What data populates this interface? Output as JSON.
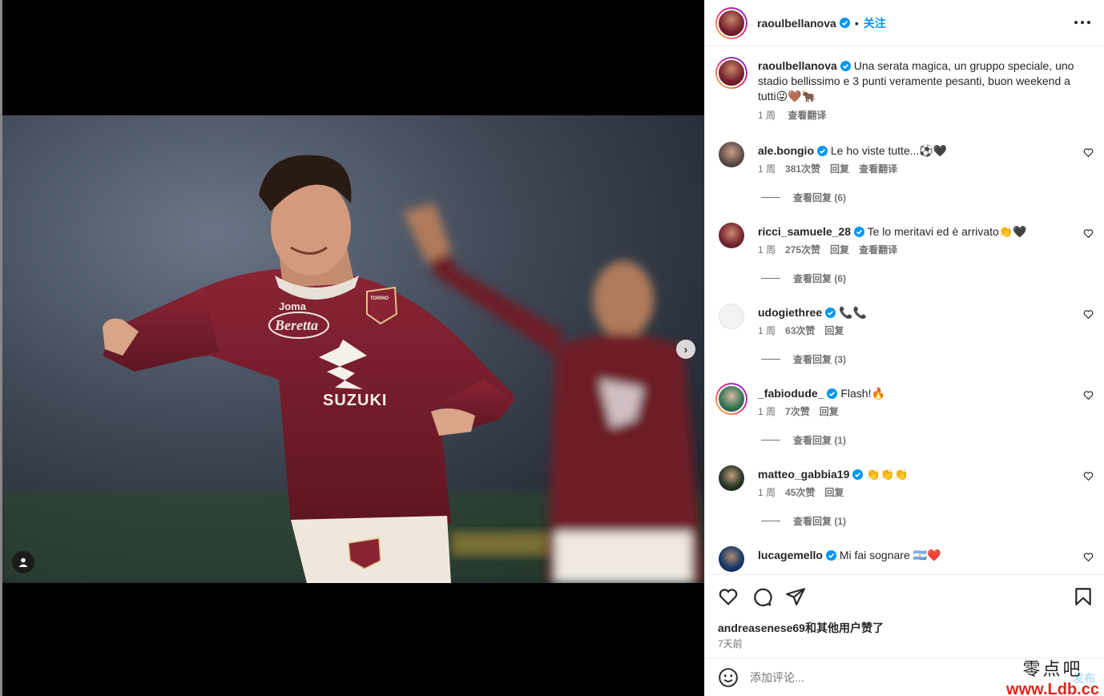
{
  "post": {
    "author": "raoulbellanova",
    "follow_label": "关注",
    "caption_text": "Una serata magica, un gruppo speciale, uno stadio bellissimo e 3 punti veramente pesanti, buon weekend a tutti😜🤎🐂",
    "caption_time": "1 周",
    "caption_translate": "查看翻译",
    "likes_text": "andreasenese69和其他用户赞了",
    "date_text": "7天前"
  },
  "photo": {
    "jersey_brand": "Joma",
    "jersey_sponsor": "Beretta",
    "jersey_main_sponsor": "SUZUKI",
    "jersey_badge": "TORINO"
  },
  "comments": [
    {
      "user": "ale.bongio",
      "text": "Le ho viste tutte...⚽🖤",
      "time": "1 周",
      "likes": "381次赞",
      "reply": "回复",
      "translate": "查看翻译",
      "view_replies": "查看回复 (6)"
    },
    {
      "user": "ricci_samuele_28",
      "text": "Te lo meritavi ed è arrivato👏🖤",
      "time": "1 周",
      "likes": "275次赞",
      "reply": "回复",
      "translate": "查看翻译",
      "view_replies": "查看回复 (6)"
    },
    {
      "user": "udogiethree",
      "text": "📞📞",
      "time": "1 周",
      "likes": "63次赞",
      "reply": "回复",
      "translate": "",
      "view_replies": "查看回复 (3)"
    },
    {
      "user": "_fabiodude_",
      "text": "Flash!🔥",
      "time": "1 周",
      "likes": "7次赞",
      "reply": "回复",
      "translate": "",
      "view_replies": "查看回复 (1)"
    },
    {
      "user": "matteo_gabbia19",
      "text": "👏👏👏",
      "time": "1 周",
      "likes": "45次赞",
      "reply": "回复",
      "translate": "",
      "view_replies": "查看回复 (1)"
    },
    {
      "user": "lucagemello",
      "text": "Mi fai sognare 🇦🇷❤️",
      "time": "",
      "likes": "",
      "reply": "",
      "translate": "",
      "view_replies": ""
    }
  ],
  "add_comment": {
    "placeholder": "添加评论...",
    "post_label": "发布"
  },
  "watermark": {
    "cn": "零点吧",
    "url": "www.Ldb.cc"
  },
  "colors": {
    "accent": "#0095f6",
    "verified": "#0095f6",
    "jersey": "#7b1e2c",
    "watermark_url": "#e0261c"
  }
}
